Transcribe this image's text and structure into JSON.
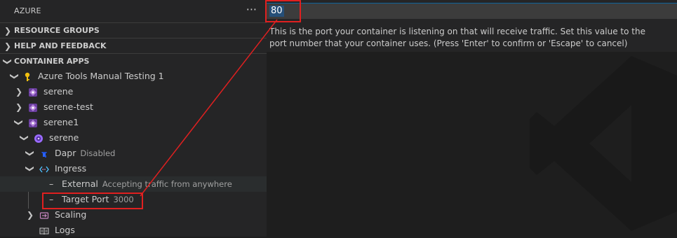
{
  "sidebar": {
    "title": "AZURE",
    "more_icon": "more-icon",
    "sections": {
      "resource_groups": "RESOURCE GROUPS",
      "help": "HELP AND FEEDBACK",
      "container_apps": "CONTAINER APPS"
    },
    "tree": {
      "subscription": "Azure Tools Manual Testing 1",
      "env1": "serene",
      "env2": "serene-test",
      "env3": "serene1",
      "app": "serene",
      "dapr": {
        "label": "Dapr",
        "desc": "Disabled"
      },
      "ingress": "Ingress",
      "external": {
        "label": "External",
        "desc": "Accepting traffic from anywhere"
      },
      "target_port": {
        "label": "Target Port",
        "desc": "3000"
      },
      "scaling": "Scaling",
      "logs": "Logs"
    }
  },
  "quick_input": {
    "value": "80",
    "message": "This is the port your container is listening on that will receive traffic. Set this value to the port number that your container uses. (Press 'Enter' to confirm or 'Escape' to cancel)"
  },
  "colors": {
    "annotation": "#e02020",
    "selection": "#264f78",
    "key_icon": "#f2c00f",
    "env_icon": "#b180d7",
    "app_icon": "#9b6bff"
  }
}
